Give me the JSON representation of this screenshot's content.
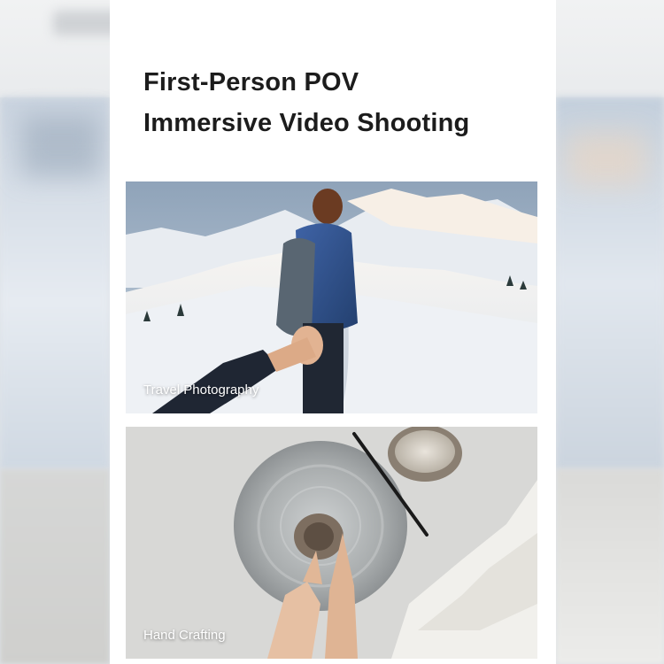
{
  "headline": {
    "line1": "First-Person POV",
    "line2": "Immersive Video Shooting"
  },
  "photos": [
    {
      "caption": "Travel Photography",
      "scene": "snowy-mountain-follow-me"
    },
    {
      "caption": "Hand Crafting",
      "scene": "pottery-wheel-hands"
    }
  ],
  "colors": {
    "card_background": "#ffffff",
    "headline_text": "#1c1c1c",
    "caption_text": "#ffffff"
  }
}
